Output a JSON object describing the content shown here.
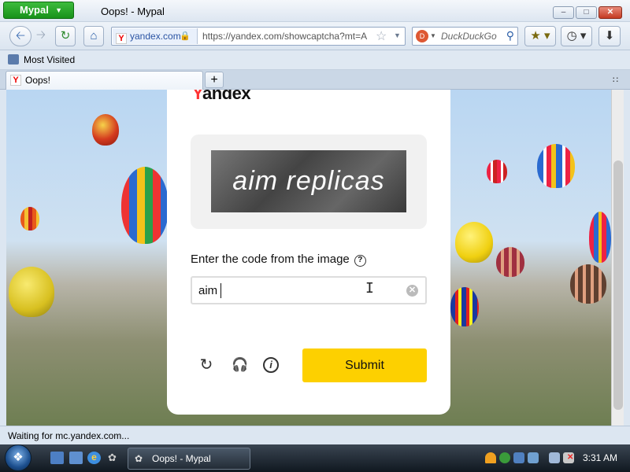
{
  "window": {
    "app_menu": "Mypal",
    "title": "Oops! - Mypal",
    "min": "–",
    "max": "□",
    "close": "✕"
  },
  "nav": {
    "identity_label": "yandex.com",
    "url": "https://yandex.com/showcaptcha?mt=A",
    "search_engine_placeholder": "DuckDuckGo"
  },
  "bookmarks": {
    "most_visited": "Most Visited"
  },
  "tabs": [
    {
      "label": "Oops!"
    }
  ],
  "page": {
    "logo_ya": "Y",
    "logo_rest": "andex",
    "captcha_text": "aim replicas",
    "code_label": "Enter the code from the image",
    "input_value": "aim",
    "submit_label": "Submit"
  },
  "status": {
    "text": "Waiting for mc.yandex.com..."
  },
  "taskbar": {
    "task_label": "Oops! - Mypal",
    "clock": "3:31 AM"
  }
}
